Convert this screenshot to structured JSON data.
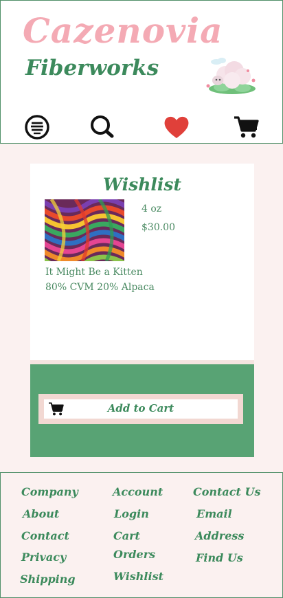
{
  "header": {
    "brand_line1": "Cazenovia",
    "brand_line2": "Fiberworks"
  },
  "nav": {
    "items": [
      "menu-icon",
      "search-icon",
      "heart-icon",
      "cart-icon"
    ],
    "heart_color": "#e0403a"
  },
  "wishlist": {
    "title": "Wishlist",
    "item": {
      "weight": "4 oz",
      "price": "$30.00",
      "name": "It Might Be a Kitten",
      "fiber": "80% CVM 20% Alpaca"
    },
    "add_to_cart_label": "Add to Cart"
  },
  "footer": {
    "col1": [
      "Company",
      "About",
      "Contact",
      "Privacy",
      "Shipping"
    ],
    "col2": [
      "Account",
      "Login",
      "Cart",
      "Orders",
      "Wishlist"
    ],
    "col3": [
      "Contact Us",
      "Email",
      "Address",
      "Find Us"
    ]
  },
  "colors": {
    "brand_pink": "#f4aab4",
    "brand_green": "#3c8a5c",
    "panel_green": "#58a374",
    "background": "#fbf1f0"
  }
}
